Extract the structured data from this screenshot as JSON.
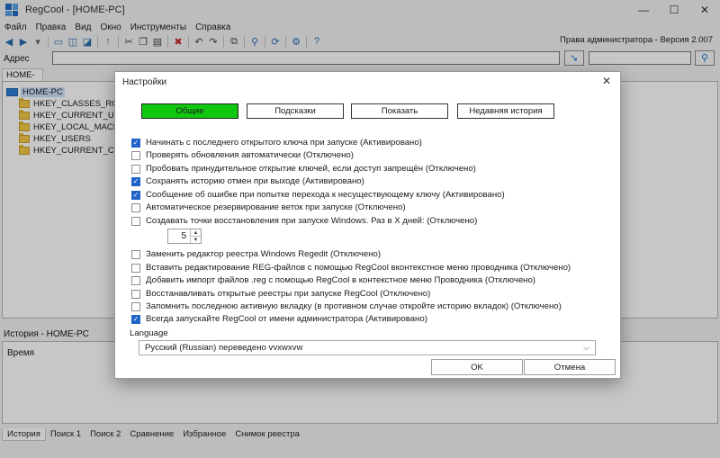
{
  "window": {
    "title": "RegCool - [HOME-PC]",
    "minimize": "—",
    "maximize": "☐",
    "close": "✕"
  },
  "menu": [
    "Файл",
    "Правка",
    "Вид",
    "Окно",
    "Инструменты",
    "Справка"
  ],
  "toolbar": {
    "admin_text": "Права администратора - Версия 2.007"
  },
  "address": {
    "label": "Адрес",
    "value": "",
    "search_value": ""
  },
  "tab": "HOME-PC",
  "tree": {
    "root": "HOME-PC",
    "keys": [
      "HKEY_CLASSES_ROOT",
      "HKEY_CURRENT_USER",
      "HKEY_LOCAL_MACHIN",
      "HKEY_USERS",
      "HKEY_CURRENT_CONFI"
    ]
  },
  "history": {
    "label": "История - HOME-PC",
    "column": "Время"
  },
  "bottom_tabs": [
    "История",
    "Поиск 1",
    "Поиск 2",
    "Сравнение",
    "Избранное",
    "Снимок реестра"
  ],
  "dialog": {
    "title": "Настройки",
    "close": "✕",
    "tabs": [
      "Общие",
      "Подсказки",
      "Показать",
      "Недавняя история"
    ],
    "options": [
      {
        "label": "Начинать с последнего открытого ключа при запуске (Активировано)",
        "checked": true
      },
      {
        "label": "Проверять обновления автоматически (Отключено)",
        "checked": false
      },
      {
        "label": "Пробовать принудительное открытие ключей, если доступ запрещён (Отключено)",
        "checked": false
      },
      {
        "label": "Сохранять историю отмен при выходе (Активировано)",
        "checked": true
      },
      {
        "label": "Сообщение об ошибке при попытке перехода к несуществующему ключу (Активировано)",
        "checked": true
      },
      {
        "label": "Автоматическое резервирование веток при запуске (Отключено)",
        "checked": false
      },
      {
        "label": "Создавать точки восстановления при запуске Windows. Раз в X дней: (Отключено)",
        "checked": false
      },
      {
        "label": "Заменить редактор реестра Windows Regedit (Отключено)",
        "checked": false
      },
      {
        "label": "Вставить редактирование REG-файлов с помощью RegCool вконтекстное меню проводника (Отключено)",
        "checked": false
      },
      {
        "label": "Добавить импорт файлов .reg с помощью RegCool в контекстное меню Проводника (Отключено)",
        "checked": false
      },
      {
        "label": "Восстанавливать открытые реестры при запуске RegCool (Отключено)",
        "checked": false
      },
      {
        "label": "Запомнить последнюю активную вкладку (в противном случае откройте историю вкладок) (Отключено)",
        "checked": false
      },
      {
        "label": "Всегда запускайте RegCool от имени администратора (Активировано)",
        "checked": true
      }
    ],
    "days_value": "5",
    "language_label": "Language",
    "language_value": "Русский (Russian) переведено vvxwxvw",
    "ok": "OK",
    "cancel": "Отмена"
  }
}
